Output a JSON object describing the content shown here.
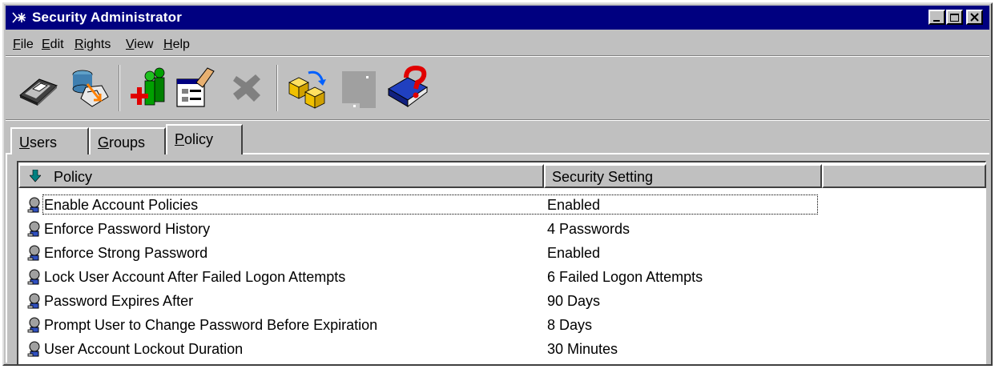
{
  "window": {
    "title": "Security Administrator"
  },
  "titlebar_buttons": [
    "minimize-icon",
    "maximize-icon",
    "close-icon"
  ],
  "menu": [
    {
      "label": "File",
      "u": "F",
      "rest": "ile"
    },
    {
      "label": "Edit",
      "u": "E",
      "rest": "dit"
    },
    {
      "label": "Rights",
      "u": "R",
      "rest": "ights"
    },
    {
      "label": "View",
      "u": "V",
      "rest": "iew"
    },
    {
      "label": "Help",
      "u": "H",
      "rest": "elp"
    }
  ],
  "toolbar": [
    {
      "icon": "save-disk-icon"
    },
    {
      "icon": "database-import-icon"
    },
    {
      "icon": "add-users-icon"
    },
    {
      "icon": "edit-properties-icon"
    },
    {
      "icon": "delete-icon"
    },
    {
      "icon": "refresh-cubes-icon"
    },
    {
      "icon": "disabled-tool-icon"
    },
    {
      "icon": "help-book-icon"
    }
  ],
  "tabs": [
    {
      "label": "Users",
      "u": "U",
      "rest": "sers"
    },
    {
      "label": "Groups",
      "u": "G",
      "rest": "roups"
    },
    {
      "label": "Policy",
      "u": "P",
      "rest": "olicy",
      "active": true
    }
  ],
  "list": {
    "columns": [
      "Policy",
      "Security Setting"
    ],
    "rows": [
      {
        "policy": "Enable Account Policies",
        "setting": "Enabled",
        "selected": true
      },
      {
        "policy": "Enforce Password History",
        "setting": "4 Passwords"
      },
      {
        "policy": "Enforce Strong Password",
        "setting": "Enabled"
      },
      {
        "policy": "Lock User Account After Failed Logon Attempts",
        "setting": "6 Failed Logon Attempts"
      },
      {
        "policy": "Password Expires After",
        "setting": "90 Days"
      },
      {
        "policy": "Prompt User to Change Password Before Expiration",
        "setting": "8 Days"
      },
      {
        "policy": "User Account Lockout Duration",
        "setting": "30 Minutes"
      }
    ]
  },
  "colors": {
    "titlebar": "#000080",
    "face": "#c0c0c0",
    "sort_arrow": "#008080"
  }
}
